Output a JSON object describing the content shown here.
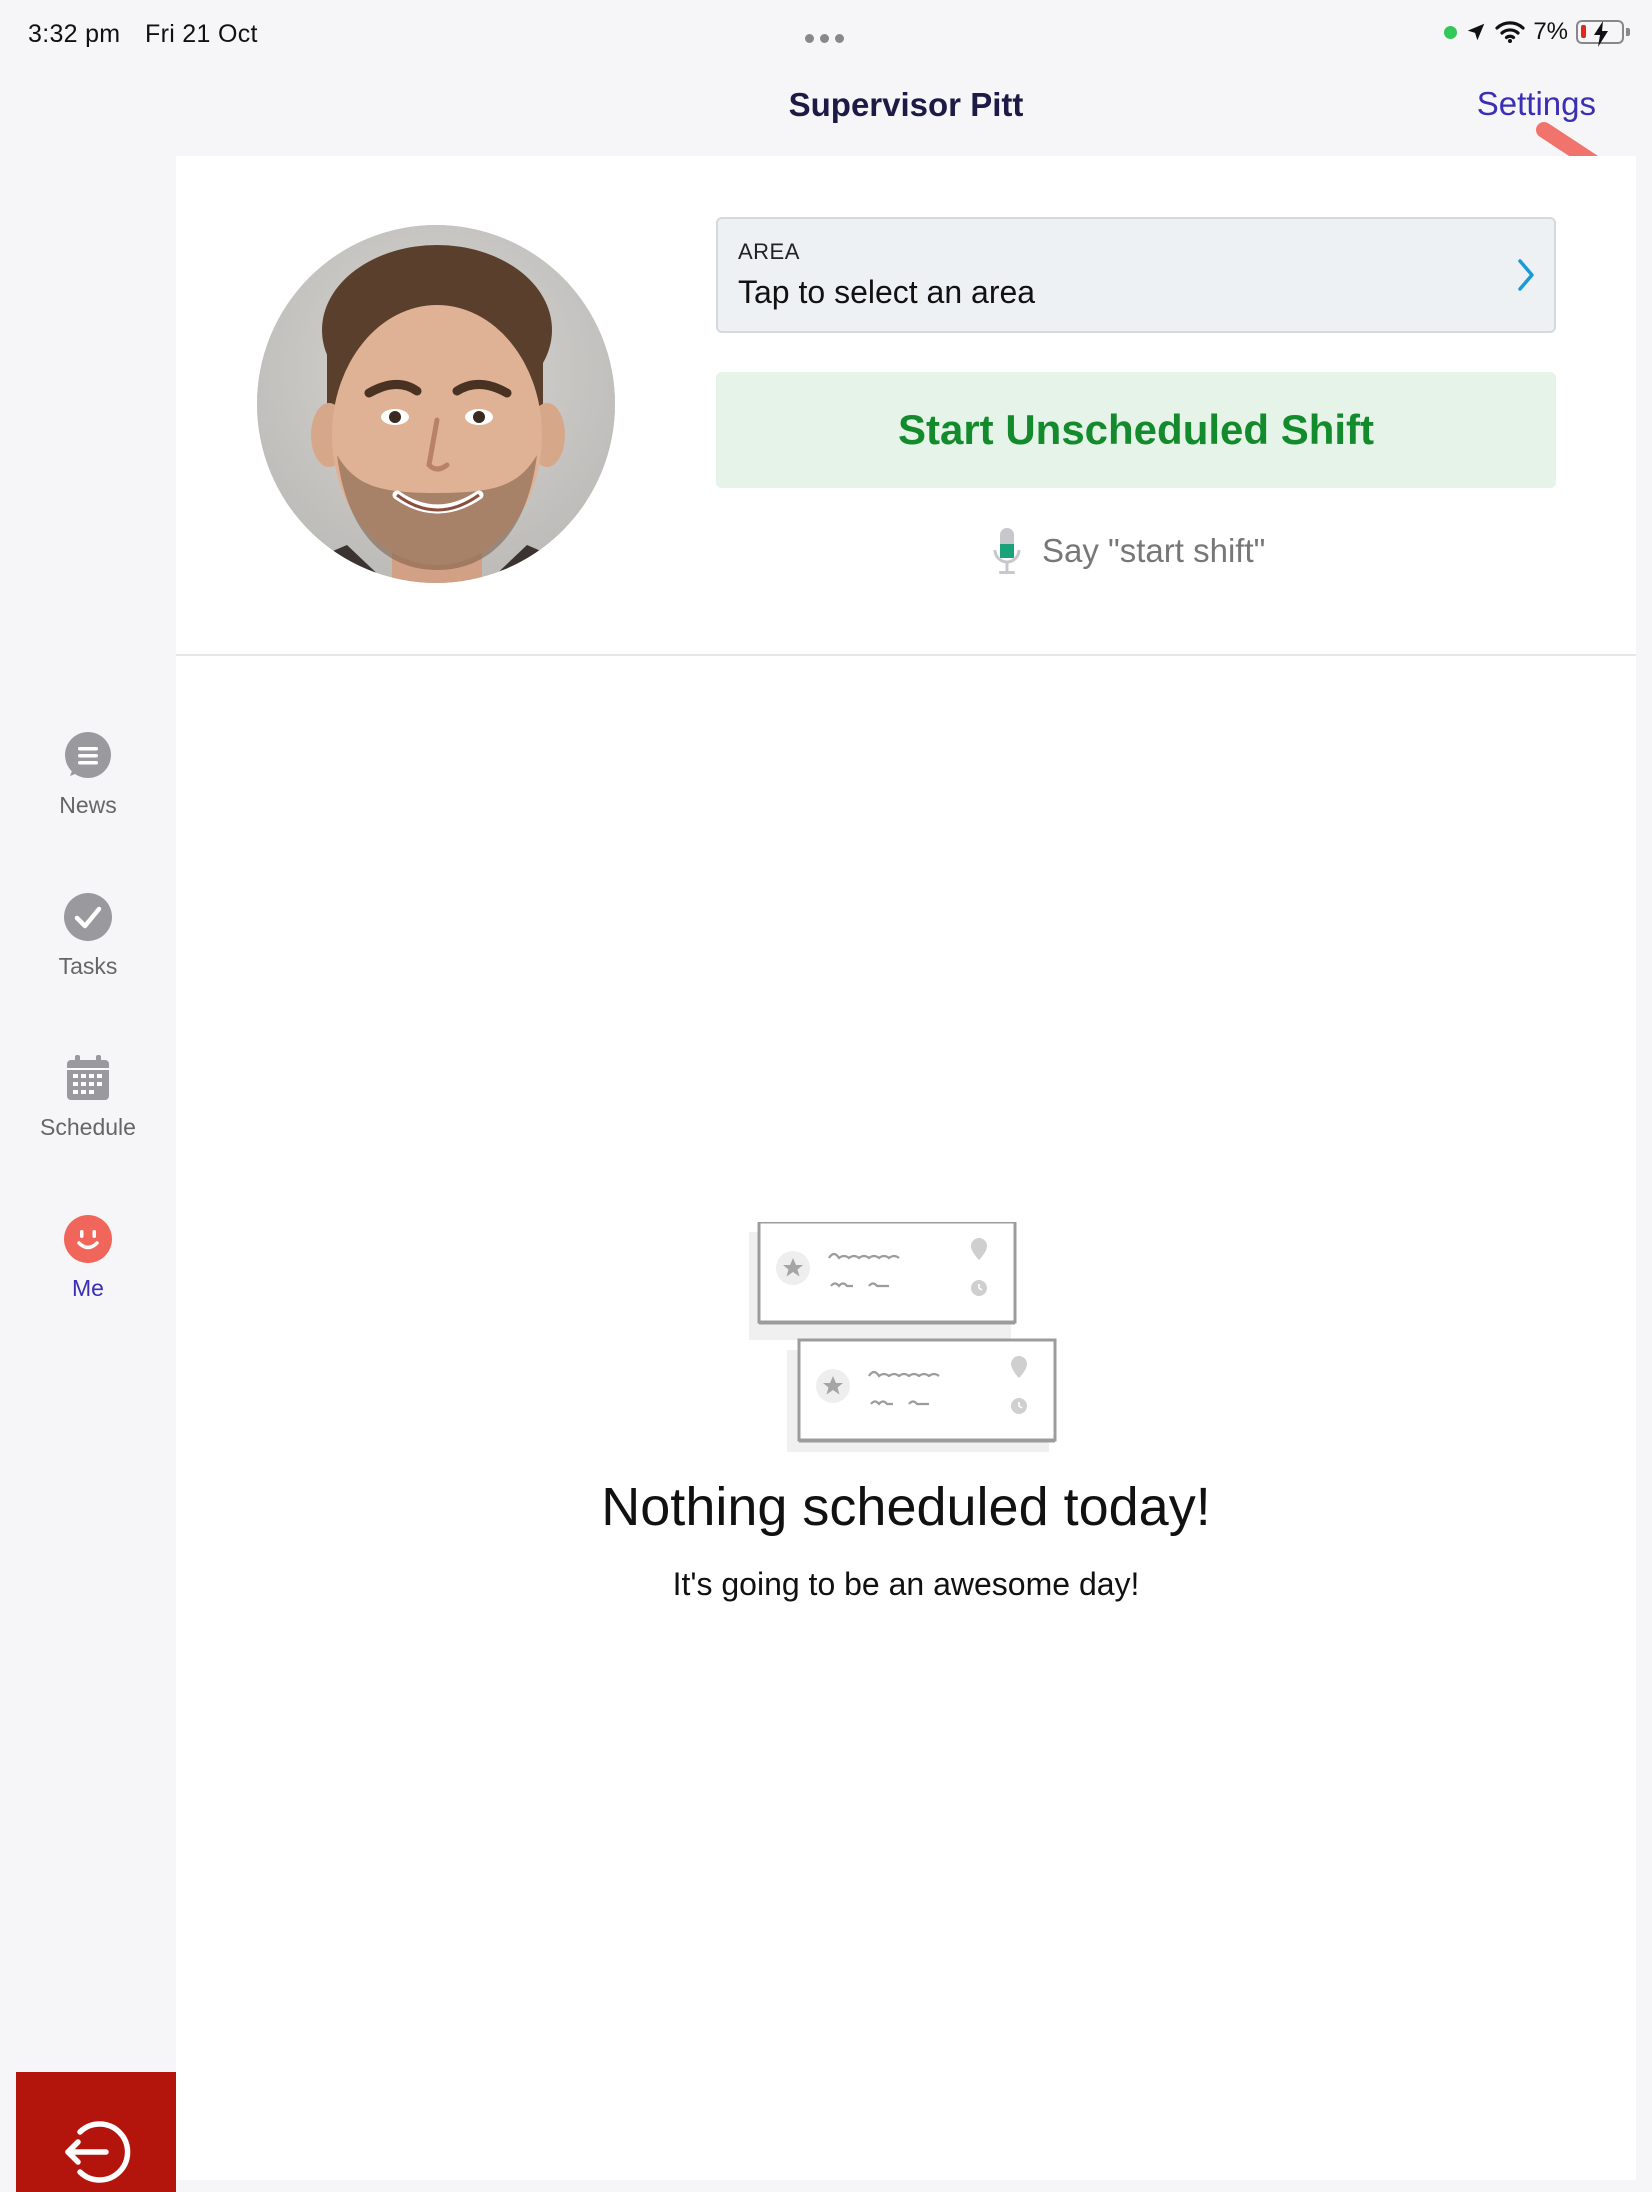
{
  "status_bar": {
    "time": "3:32 pm",
    "date": "Fri 21 Oct",
    "battery": "7%"
  },
  "header": {
    "title": "Supervisor Pitt",
    "settings_label": "Settings"
  },
  "sidebar": {
    "items": [
      {
        "label": "News",
        "icon": "news-icon"
      },
      {
        "label": "Tasks",
        "icon": "check-icon"
      },
      {
        "label": "Schedule",
        "icon": "calendar-icon"
      },
      {
        "label": "Me",
        "icon": "smiley-icon",
        "active": true
      }
    ],
    "logout_icon": "logout-icon"
  },
  "profile": {
    "area_label": "AREA",
    "area_value": "Tap to select an area",
    "start_shift_label": "Start Unscheduled Shift",
    "voice_hint": "Say \"start shift\""
  },
  "empty_state": {
    "title": "Nothing scheduled today!",
    "subtitle": "It's going to be an awesome day!"
  },
  "colors": {
    "accent": "#3b2fb5",
    "start_green": "#138a2c",
    "start_bg": "#e5f3e8",
    "logout_red": "#b3140b",
    "me_icon": "#f1665a",
    "annotation_arrow": "#f0746c"
  }
}
